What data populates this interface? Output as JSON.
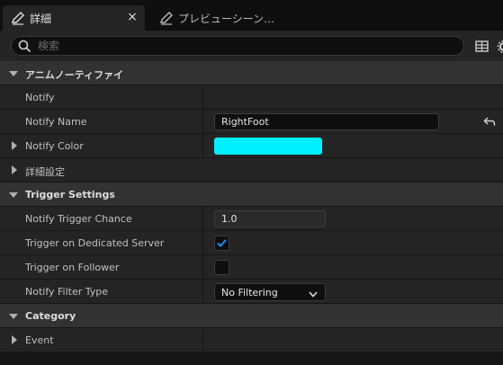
{
  "tabs": [
    {
      "label": "詳細",
      "active": true,
      "icon": "pencil-icon",
      "close": "×"
    },
    {
      "label": "プレビューシーン…",
      "active": false,
      "icon": "pencil-icon"
    }
  ],
  "search": {
    "placeholder": "検索",
    "value": ""
  },
  "toolbar": {
    "icons": [
      "table-view-icon",
      "settings-gear-icon"
    ]
  },
  "sections": [
    {
      "title": "アニムノーティファイ",
      "expanded": true,
      "rows": [
        {
          "name": "Notify",
          "type": "empty"
        },
        {
          "name": "Notify Name",
          "type": "text",
          "value": "RightFoot",
          "reset_icon": "reset-arrow-icon"
        },
        {
          "name": "Notify Color",
          "type": "color",
          "value": "#00f0ff",
          "expandable": true
        },
        {
          "name": "詳細設定",
          "type": "group",
          "expandable": true
        }
      ]
    },
    {
      "title": "Trigger Settings",
      "expanded": true,
      "rows": [
        {
          "name": "Notify Trigger Chance",
          "type": "number",
          "value": "1.0"
        },
        {
          "name": "Trigger on Dedicated Server",
          "type": "checkbox",
          "checked": true
        },
        {
          "name": "Trigger on Follower",
          "type": "checkbox",
          "checked": false
        },
        {
          "name": "Notify Filter Type",
          "type": "dropdown",
          "value": "No Filtering"
        }
      ]
    },
    {
      "title": "Category",
      "expanded": true,
      "rows": [
        {
          "name": "Event",
          "type": "empty",
          "expandable": true
        }
      ]
    }
  ],
  "colors": {
    "accent_check": "#1a8fff",
    "notify_color": "#00f0ff"
  }
}
